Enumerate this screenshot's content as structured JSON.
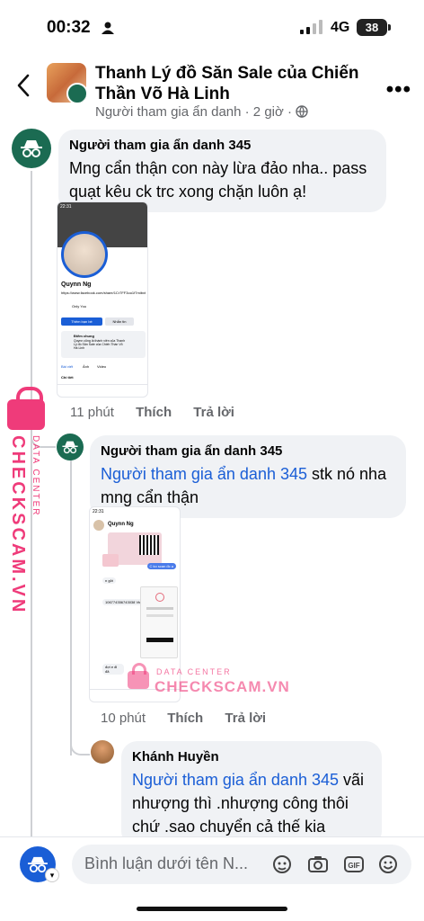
{
  "status_bar": {
    "time": "00:32",
    "network": "4G",
    "battery": "38"
  },
  "header": {
    "title": "Thanh Lý đồ Săn Sale của Chiến Thần Võ Hà Linh",
    "subtitle": "Người tham gia ẩn danh · 2 giờ ·",
    "more_label": "•••"
  },
  "comments": [
    {
      "author": "Người tham gia ẩn danh 345",
      "text": "Mng cẩn thận con này lừa đảo nha.. pass quạt kêu ck trc xong chặn luôn ạ!",
      "time": "11 phút",
      "like": "Thích",
      "reply": "Trả lời",
      "screenshot": {
        "profile_name": "Quynn Ng",
        "profile_link": "https://www.facebook.com/share/1Cr7FF3oo1f7mibxtdnwwXfr",
        "music": "Only You",
        "add_friend": "Thêm bạn bè",
        "message": "Nhắn tin",
        "common_title": "Điểm chung",
        "common_text": "Quynn cũng là thành viên của Thanh Lý đồ Săn Sale của Chiến Thần Võ Hà Linh",
        "tabs": [
          "Bài viết",
          "Ảnh",
          "Video"
        ],
        "details": "Chi tiết"
      }
    },
    {
      "author": "Người tham gia ẩn danh 345",
      "mention": "Người tham gia ẩn danh 345",
      "text": " stk nó nha mng cẩn thận",
      "time": "10 phút",
      "like": "Thích",
      "reply": "Trả lời",
      "screenshot": {
        "chat_name": "Quynn Ng",
        "msg_1": "n gửi",
        "msg_2": "C ko scan đc ạ",
        "msg_3": "106774356743038 Vtech ạ",
        "msg_4": "đợi e đi đã"
      }
    },
    {
      "author": "Khánh Huyền",
      "mention": "Người tham gia ẩn danh 345",
      "text": " vãi nhượng thì .nhượng công thôi chứ .sao chuyển cả thế kia"
    }
  ],
  "composer": {
    "placeholder": "Bình luận dưới tên N..."
  },
  "watermark": {
    "line1": "DATA CENTER",
    "line2": "CHECKSCAM.VN"
  },
  "colors": {
    "mention": "#1a5ed6",
    "anon_avatar": "#1b6b52",
    "watermark": "#ef3b7a"
  }
}
